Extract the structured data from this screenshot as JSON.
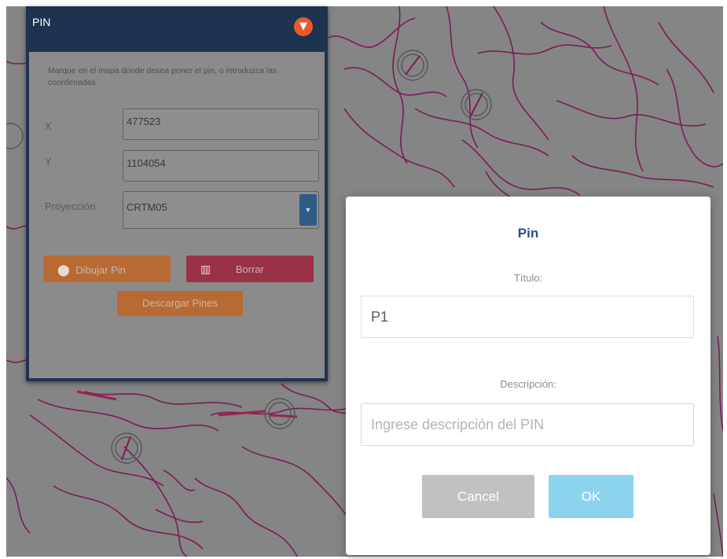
{
  "pin_panel": {
    "title": "PIN",
    "collapse_icon": "chevron-down-icon",
    "instructions": "Marque en el mapa donde desea poner el pin, o introduzca las coordenadas",
    "x_label": "X",
    "x_value": "477523",
    "y_label": "Y",
    "y_value": "1104054",
    "projection_label": "Proyección",
    "projection_value": "CRTM05",
    "draw_pin_label": "Dibujar Pin",
    "draw_pin_icon": "map-marker-icon",
    "delete_label": "Borrar",
    "delete_icon": "trash-icon",
    "download_label": "Descargar Pines"
  },
  "modal": {
    "title": "Pin",
    "title_label": "Título:",
    "title_value": "P1",
    "description_label": "Descripción:",
    "description_placeholder": "Ingrese descripción del PIN",
    "cancel_label": "Cancel",
    "ok_label": "OK"
  },
  "colors": {
    "panel_header": "#1e3350",
    "map_overlay": "#858585",
    "map_borders": "#8a1a5c",
    "draw_button": "#b86a34",
    "delete_button": "#9a3245",
    "modal_title": "#2d4f7c",
    "ok_button": "#8cd3ee",
    "cancel_button": "#c1c1c1"
  }
}
